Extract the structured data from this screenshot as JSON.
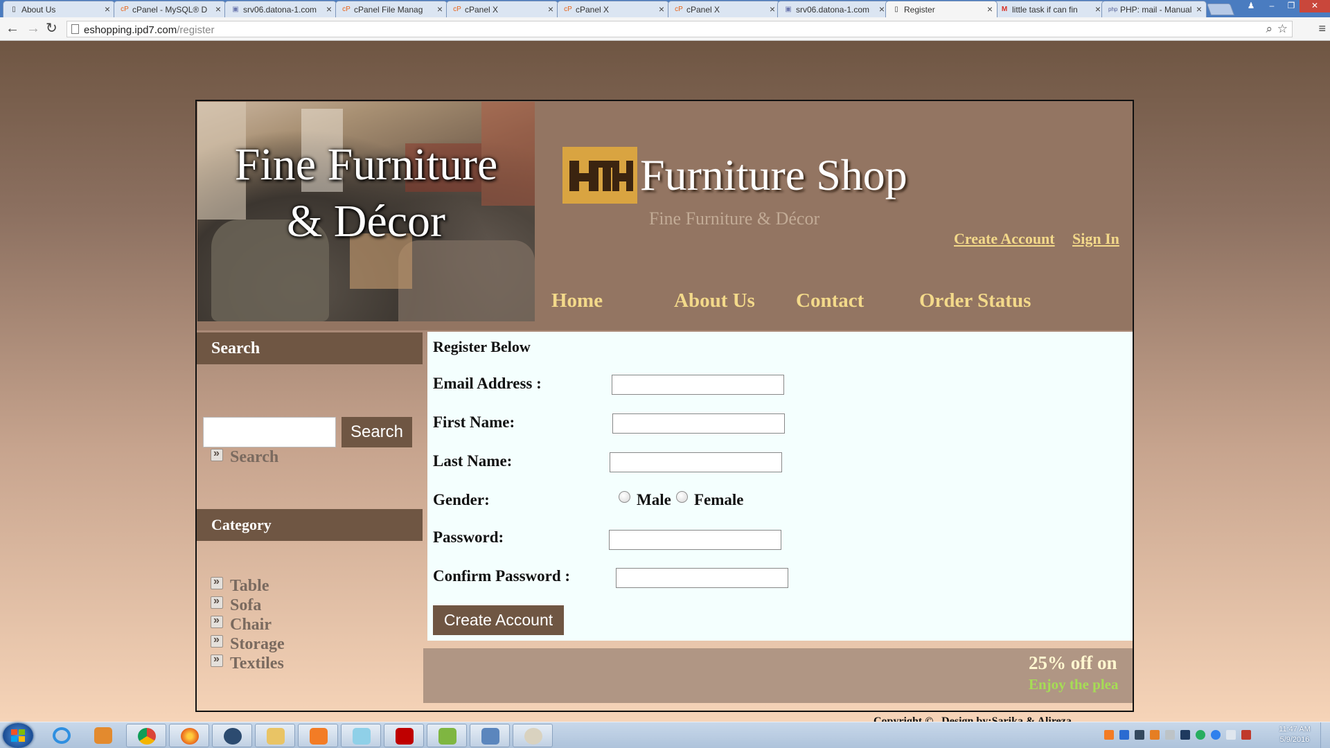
{
  "browser": {
    "tabs": [
      {
        "title": "About Us",
        "icon": "page-icon"
      },
      {
        "title": "cPanel - MySQL® D",
        "icon": "cpanel-icon"
      },
      {
        "title": "srv06.datona-1.com",
        "icon": "phpmyadmin-icon"
      },
      {
        "title": "cPanel File Manag",
        "icon": "cpanel-icon"
      },
      {
        "title": "cPanel X",
        "icon": "cpanel-icon"
      },
      {
        "title": "cPanel X",
        "icon": "cpanel-icon"
      },
      {
        "title": "cPanel X",
        "icon": "cpanel-icon"
      },
      {
        "title": "srv06.datona-1.com",
        "icon": "phpmyadmin-icon"
      },
      {
        "title": "Register",
        "icon": "page-icon",
        "active": true
      },
      {
        "title": "little task if can fin",
        "icon": "gmail-icon"
      },
      {
        "title": "PHP: mail - Manual",
        "icon": "php-icon"
      }
    ],
    "url_host": "eshopping.ipd7.com",
    "url_path": "/register"
  },
  "site": {
    "banner_line1": "Fine Furniture",
    "banner_line2": "& Décor",
    "title": "Furniture Shop",
    "subtitle": "Fine Furniture & Décor",
    "create_account_link": "Create Account",
    "sign_in_link": "Sign In",
    "nav": {
      "home": "Home",
      "about": "About Us",
      "contact": "Contact",
      "order_status": "Order Status"
    }
  },
  "sidebar": {
    "search_heading": "Search",
    "search_placeholder": "",
    "search_button": "Search",
    "search_link": "Search",
    "category_heading": "Category",
    "categories": [
      "Table",
      "Sofa",
      "Chair",
      "Storage",
      "Textiles"
    ]
  },
  "form": {
    "heading": "Register Below",
    "email_label": "Email Address :",
    "first_name_label": "First Name:",
    "last_name_label": "Last Name:",
    "gender_label": "Gender:",
    "male_label": "Male",
    "female_label": "Female",
    "password_label": "Password:",
    "confirm_password_label": "Confirm Password :",
    "submit_button": "Create Account",
    "email_value": "",
    "first_name_value": "",
    "last_name_value": "",
    "password_value": "",
    "confirm_password_value": ""
  },
  "promo": {
    "line1": "25% off on",
    "line2": "Enjoy the plea"
  },
  "footer": {
    "copyright": "Copyright © , Design by:Sarika & Alireza"
  },
  "taskbar": {
    "apps": [
      "internet-explorer-icon",
      "media-player-icon",
      "chrome-icon",
      "firefox-icon",
      "app-tree-icon",
      "file-explorer-icon",
      "xampp-icon",
      "notepad-icon",
      "filezilla-icon",
      "chart-app-icon",
      "cube-app-icon",
      "paint-icon"
    ],
    "clock_time": "11:47 AM",
    "clock_date": "5/9/2016"
  },
  "colors": {
    "brown": "#6f5643",
    "header_bg": "#937562",
    "gold_link": "#f3d98a",
    "form_bg": "#f4fffe"
  }
}
